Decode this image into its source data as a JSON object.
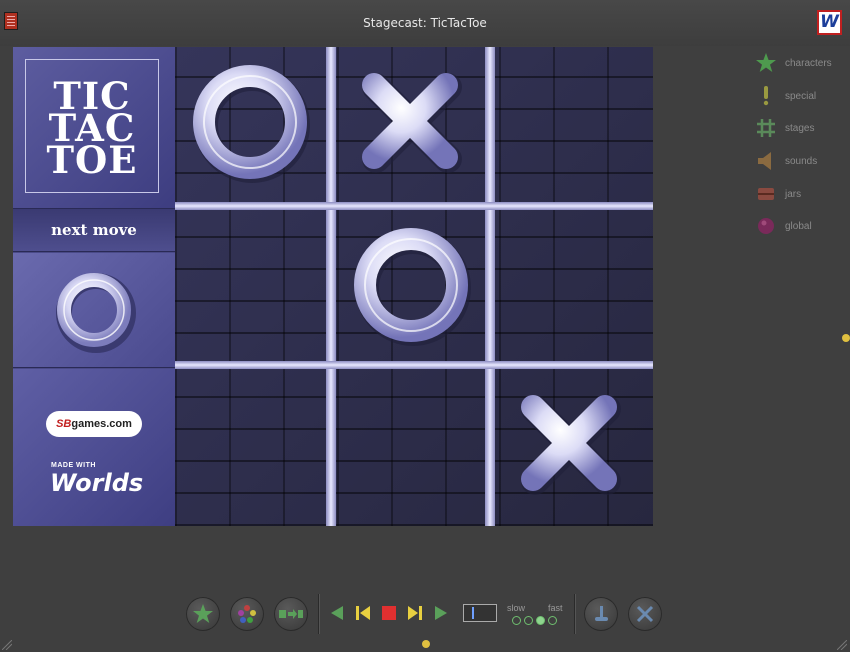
{
  "window": {
    "title": "Stagecast: TicTacToe",
    "logo_letter": "W"
  },
  "logo": {
    "lines": [
      "TIC",
      "TAC",
      "TOE"
    ]
  },
  "next_move": {
    "label": "next move",
    "piece": "O"
  },
  "branding": {
    "publisher_prefix": "SB",
    "publisher_suffix": "games.com",
    "made_with": "MADE WITH",
    "product": "Worlds"
  },
  "board": {
    "cells": [
      "O",
      "X",
      "",
      "",
      "O",
      "",
      "",
      "",
      "X"
    ]
  },
  "sidebar": {
    "items": [
      {
        "label": "characters",
        "icon": "star-icon"
      },
      {
        "label": "special",
        "icon": "exclamation-icon"
      },
      {
        "label": "stages",
        "icon": "grid-icon"
      },
      {
        "label": "sounds",
        "icon": "speaker-icon"
      },
      {
        "label": "jars",
        "icon": "jar-icon"
      },
      {
        "label": "global",
        "icon": "globe-icon"
      }
    ]
  },
  "toolbar": {
    "speed_slow": "slow",
    "speed_fast": "fast",
    "speed_level": 3,
    "speed_levels": 4
  },
  "colors": {
    "accent_green": "#5aa05a",
    "stop_red": "#e03030",
    "step_yellow": "#e8d040",
    "board_blue": "#4a4a88"
  }
}
